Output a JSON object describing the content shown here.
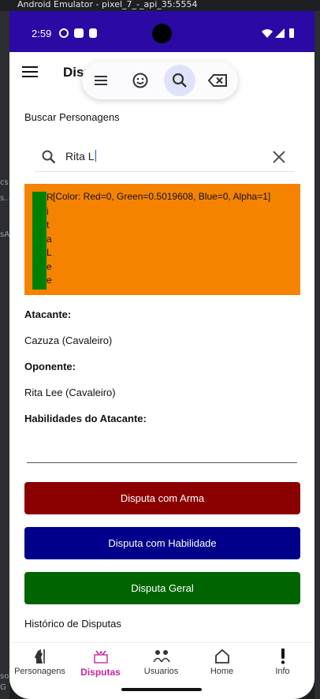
{
  "window": {
    "title": "Android Emulator - pixel_7_-_api_35:5554"
  },
  "left_strip": {
    "fragments": [
      "cs",
      "s...",
      "sA",
      "so",
      "G"
    ]
  },
  "status_bar": {
    "time": "2:59",
    "bg_color": "#2a09a4"
  },
  "app_bar": {
    "title": "Disp"
  },
  "keyboard_toolbar": {
    "buttons": [
      {
        "icon": "menu-icon"
      },
      {
        "icon": "emoji-icon"
      },
      {
        "icon": "search-icon",
        "active": true
      },
      {
        "icon": "backspace-icon"
      }
    ]
  },
  "search": {
    "section_label": "Buscar Personagens",
    "value": "Rita L"
  },
  "selected_item": {
    "vertical_letters": [
      "R",
      "i",
      "t",
      "a",
      "L",
      "e",
      "e"
    ],
    "color_text": "[Color: Red=0, Green=0.5019608, Blue=0, Alpha=1]",
    "bg_color": "#f58300",
    "bar_color": "#008000"
  },
  "details": {
    "attacker_label": "Atacante:",
    "attacker_value": "Cazuza (Cavaleiro)",
    "opponent_label": "Oponente:",
    "opponent_value": "Rita Lee (Cavaleiro)",
    "skills_label": "Habilidades do Atacante:",
    "history_label": "Histórico de Disputas"
  },
  "buttons": {
    "weapon": {
      "label": "Disputa com Arma",
      "color": "#8b0000"
    },
    "skill": {
      "label": "Disputa com Habilidade",
      "color": "#00008b"
    },
    "general": {
      "label": "Disputa Geral",
      "color": "#006400"
    }
  },
  "bottom_nav": {
    "items": [
      {
        "label": "Personagens",
        "icon": "knight-icon"
      },
      {
        "label": "Disputas",
        "icon": "duel-icon",
        "active": true
      },
      {
        "label": "Usuarios",
        "icon": "users-icon"
      },
      {
        "label": "Home",
        "icon": "home-icon"
      },
      {
        "label": "Info",
        "icon": "info-icon"
      }
    ]
  }
}
